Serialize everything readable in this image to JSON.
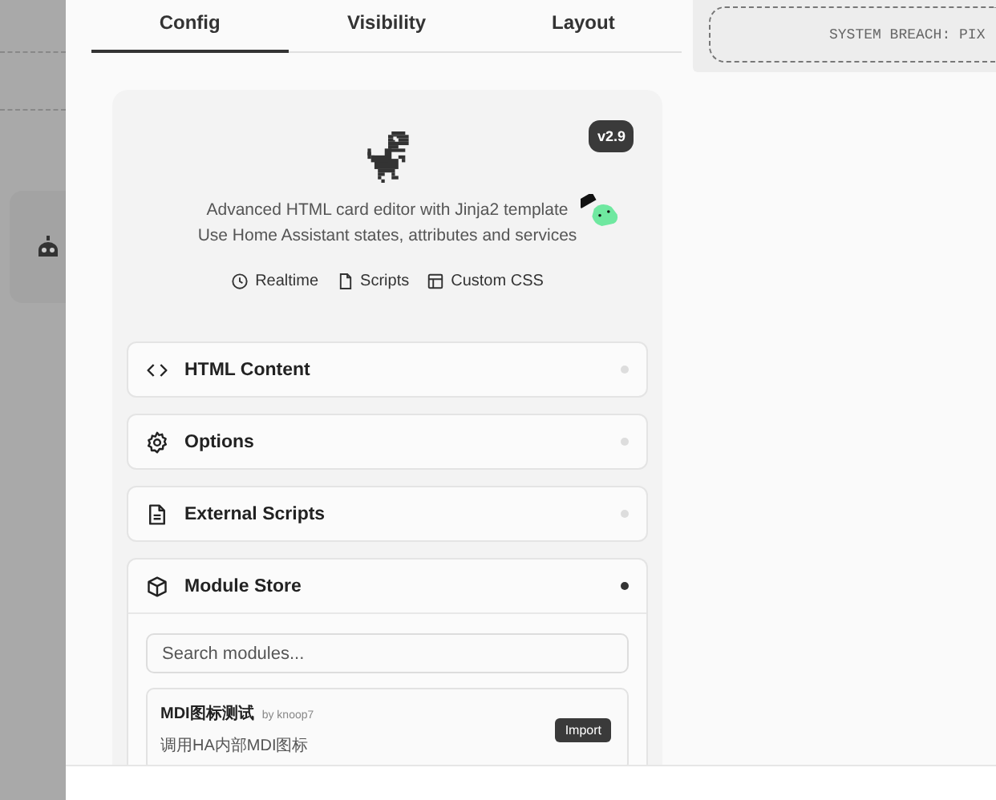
{
  "tabs": [
    {
      "label": "Config",
      "selected": true
    },
    {
      "label": "Visibility",
      "selected": false
    },
    {
      "label": "Layout",
      "selected": false
    }
  ],
  "preview": {
    "text": "SYSTEM BREACH: PIX"
  },
  "header": {
    "version": "v2.9",
    "description": [
      "Advanced HTML card editor with Jinja2 template",
      "Use Home Assistant states, attributes and services"
    ],
    "features": [
      {
        "label": "Realtime"
      },
      {
        "label": "Scripts"
      },
      {
        "label": "Custom CSS"
      }
    ]
  },
  "sections": [
    {
      "title": "HTML Content",
      "expanded": false
    },
    {
      "title": "Options",
      "expanded": false
    },
    {
      "title": "External Scripts",
      "expanded": false
    },
    {
      "title": "Module Store",
      "expanded": true
    }
  ],
  "module_store": {
    "search": {
      "placeholder": "Search modules..."
    },
    "modules": [
      {
        "name": "MDI图标测试",
        "author": "by knoop7",
        "description": "调用HA内部MDI图标",
        "action": "Import"
      }
    ]
  }
}
